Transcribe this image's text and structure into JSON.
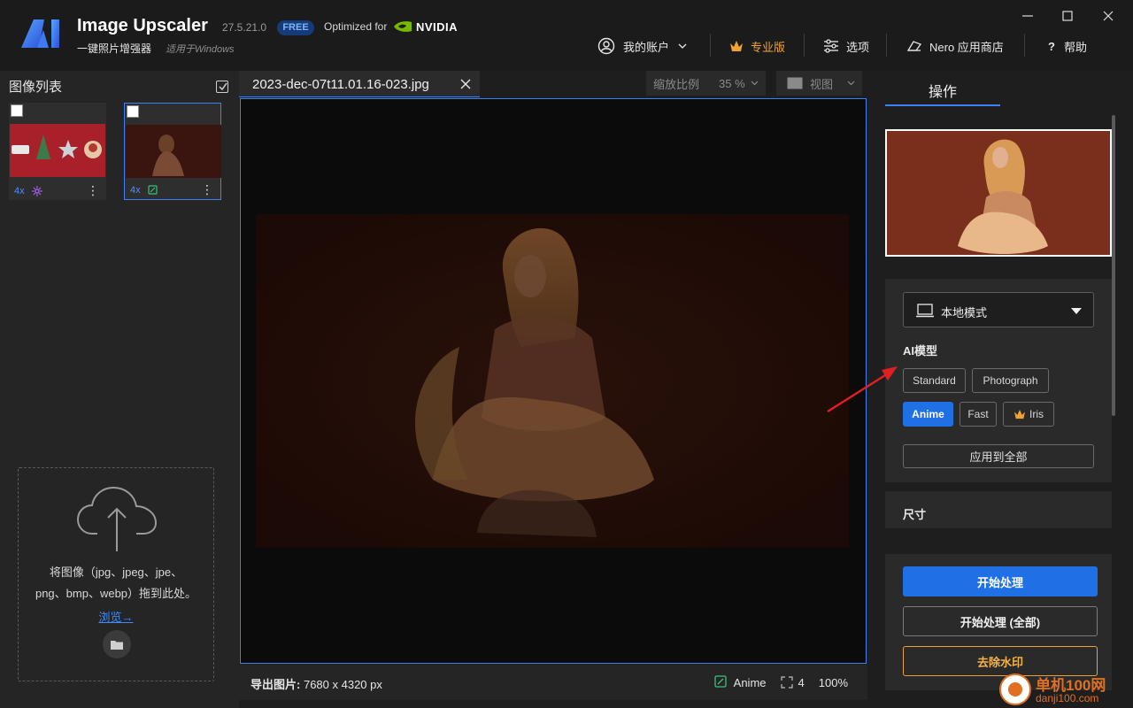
{
  "app": {
    "title": "Image Upscaler",
    "version": "27.5.21.0",
    "badge": "FREE",
    "optimized_for": "Optimized for",
    "nvidia": "NVIDIA",
    "subtitle": "一键照片增强器",
    "subtitle_platform": "适用于Windows"
  },
  "nav": {
    "account": "我的账户",
    "pro": "专业版",
    "options": "选项",
    "store": "Nero 应用商店",
    "help": "帮助"
  },
  "image_list": {
    "title": "图像列表",
    "items": [
      {
        "scale": "4x",
        "model_icon": "sparkle-icon",
        "checked": false,
        "selected": false
      },
      {
        "scale": "4x",
        "model_icon": "anime-icon",
        "checked": false,
        "selected": true
      }
    ],
    "drop_text_line1": "将图像（jpg、jpeg、jpe、",
    "drop_text_line2": "png、bmp、webp）拖到此处。",
    "browse": "浏览→"
  },
  "editor": {
    "file_tab": "2023-dec-07t11.01.16-023.jpg",
    "zoom_label": "缩放比例",
    "zoom_value": "35 %",
    "view_label": "视图",
    "export_label": "导出图片:",
    "export_size": "7680 x 4320 px",
    "status_model": "Anime",
    "status_scale": "4",
    "status_quality": "100%"
  },
  "operations": {
    "tab": "操作",
    "mode": "本地模式",
    "ai_model_label": "AI模型",
    "models": [
      "Standard",
      "Photograph",
      "Anime",
      "Fast",
      "Iris"
    ],
    "active_model": "Anime",
    "apply_all": "应用到全部",
    "size_label": "尺寸",
    "start": "开始处理",
    "start_all": "开始处理 (全部)",
    "remove_watermark": "去除水印"
  },
  "site_watermark": {
    "name": "单机100网",
    "url": "danji100.com"
  },
  "colors": {
    "accent": "#1f6fe5",
    "pro_gold": "#f0a233",
    "link": "#3c8bff"
  }
}
